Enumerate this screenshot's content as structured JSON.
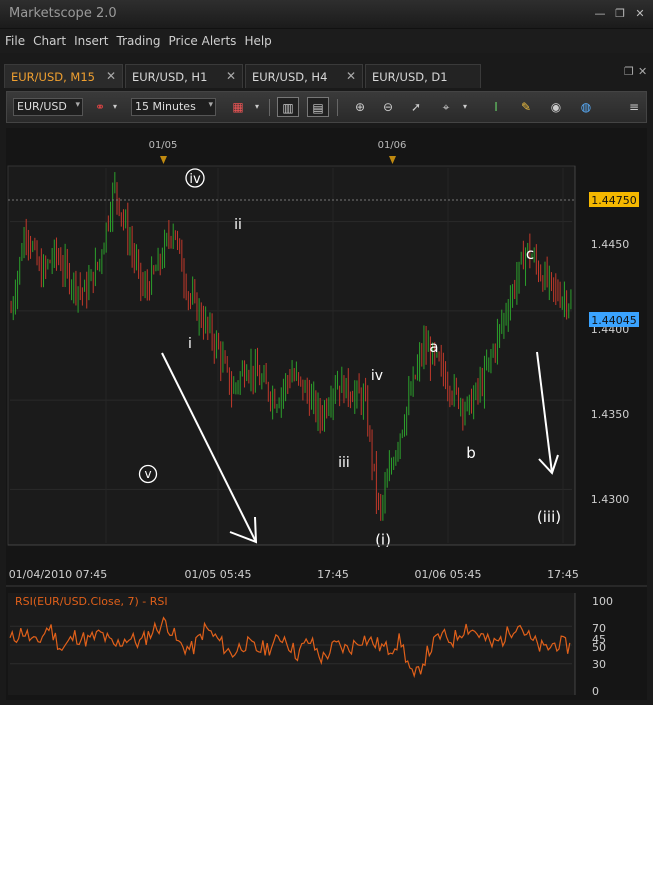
{
  "window": {
    "title": "Marketscope 2.0"
  },
  "menu": [
    "File",
    "Chart",
    "Insert",
    "Trading",
    "Price Alerts",
    "Help"
  ],
  "tabs": [
    {
      "label": "EUR/USD, M15",
      "active": true
    },
    {
      "label": "EUR/USD, H1",
      "active": false
    },
    {
      "label": "EUR/USD, H4",
      "active": false
    },
    {
      "label": "EUR/USD, D1",
      "active": false
    }
  ],
  "toolbar": {
    "symbol": "EUR/USD",
    "timeframe": "15 Minutes"
  },
  "chart_data": [
    {
      "type": "line",
      "title": "",
      "instrument": "EUR/USD",
      "series": [
        {
          "values": [
            1.44,
            1.4447,
            1.442,
            1.4432,
            1.4418,
            1.441,
            1.4428,
            1.447,
            1.444,
            1.441,
            1.4425,
            1.4448,
            1.441,
            1.4395,
            1.438,
            1.4355,
            1.437,
            1.436,
            1.435,
            1.4365,
            1.4355,
            1.434,
            1.436,
            1.4355,
            1.435,
            1.4285,
            1.432,
            1.435,
            1.438,
            1.437,
            1.4355,
            1.4345,
            1.436,
            1.4385,
            1.441,
            1.4435,
            1.442,
            1.441,
            1.4405
          ]
        }
      ],
      "ylim": [
        1.427,
        1.448
      ],
      "y_ticks": [
        "1.4450",
        "1.4400",
        "1.4350",
        "1.4300"
      ],
      "x_ticks": [
        "01/04/2010 07:45",
        "01/05 05:45",
        "17:45",
        "01/06 05:45",
        "17:45"
      ],
      "session_markers": [
        "01/05",
        "01/06"
      ],
      "price_labels": [
        {
          "value": "1.44750",
          "color": "#f5b800"
        },
        {
          "value": "1.44045",
          "color": "#3aa3ff"
        }
      ],
      "wave_labels": [
        "iv",
        "ii",
        "i",
        "v",
        "iii",
        "iv",
        "(i)",
        "a",
        "b",
        "c",
        "(iii)"
      ],
      "candle_colors": {
        "up": "#2ca02c",
        "down": "#c0392b"
      }
    },
    {
      "type": "line",
      "title": "RSI(EUR/USD.Close, 7) - RSI",
      "series": [
        {
          "name": "RSI",
          "color": "#e0601a",
          "values": [
            55,
            65,
            50,
            70,
            45,
            60,
            55,
            62,
            48,
            58,
            52,
            66,
            75,
            50,
            45,
            68,
            55,
            40,
            52,
            45,
            48,
            60,
            40,
            55,
            35,
            50,
            45,
            58,
            52,
            45,
            55,
            12,
            40,
            60,
            55,
            70,
            62,
            50,
            58,
            75,
            55,
            45,
            52,
            48
          ]
        }
      ],
      "ylim": [
        0,
        100
      ],
      "y_ticks": [
        "100",
        "70",
        "50",
        "30",
        "0"
      ],
      "extra_tick": "45"
    }
  ]
}
